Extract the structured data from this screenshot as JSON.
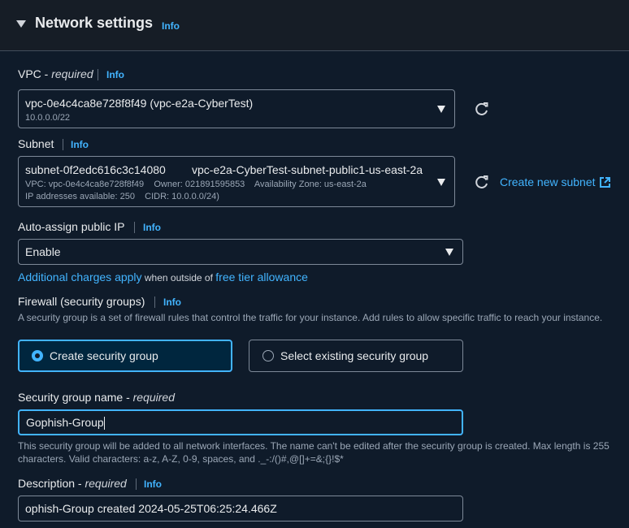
{
  "section": {
    "title": "Network settings",
    "info": "Info"
  },
  "vpc": {
    "label": "VPC - ",
    "required": "required",
    "info": "Info",
    "value": "vpc-0e4c4ca8e728f8f49 (vpc-e2a-CyberTest)",
    "sub": "10.0.0.0/22"
  },
  "subnet": {
    "label": "Subnet",
    "info": "Info",
    "id": "subnet-0f2edc616c3c14080",
    "name": "vpc-e2a-CyberTest-subnet-public1-us-east-2a",
    "line1": "VPC: vpc-0e4c4ca8e728f8f49    Owner: 021891595853    Availability Zone: us-east-2a",
    "line2": "IP addresses available: 250    CIDR: 10.0.0.0/24)",
    "create_link": "Create new subnet"
  },
  "auto_ip": {
    "label": "Auto-assign public IP",
    "info": "Info",
    "value": "Enable",
    "charges_link": "Additional charges apply",
    "charges_text": " when outside of ",
    "free_tier_link": "free tier allowance"
  },
  "firewall": {
    "label": "Firewall (security groups)",
    "info": "Info",
    "description": "A security group is a set of firewall rules that control the traffic for your instance. Add rules to allow specific traffic to reach your instance.",
    "option_create": "Create security group",
    "option_select": "Select existing security group"
  },
  "sg_name": {
    "label": "Security group name - ",
    "required": "required",
    "value": "Gophish-Group",
    "help": "This security group will be added to all network interfaces. The name can't be edited after the security group is created. Max length is 255 characters. Valid characters: a-z, A-Z, 0-9, spaces, and ._-:/()#,@[]+=&;{}!$*"
  },
  "description": {
    "label": "Description - ",
    "required": "required",
    "info": "Info",
    "value": "ophish-Group created 2024-05-25T06:25:24.466Z"
  },
  "colors": {
    "accent": "#42b4ff",
    "background": "#0f1b2a",
    "header": "#161d26"
  }
}
